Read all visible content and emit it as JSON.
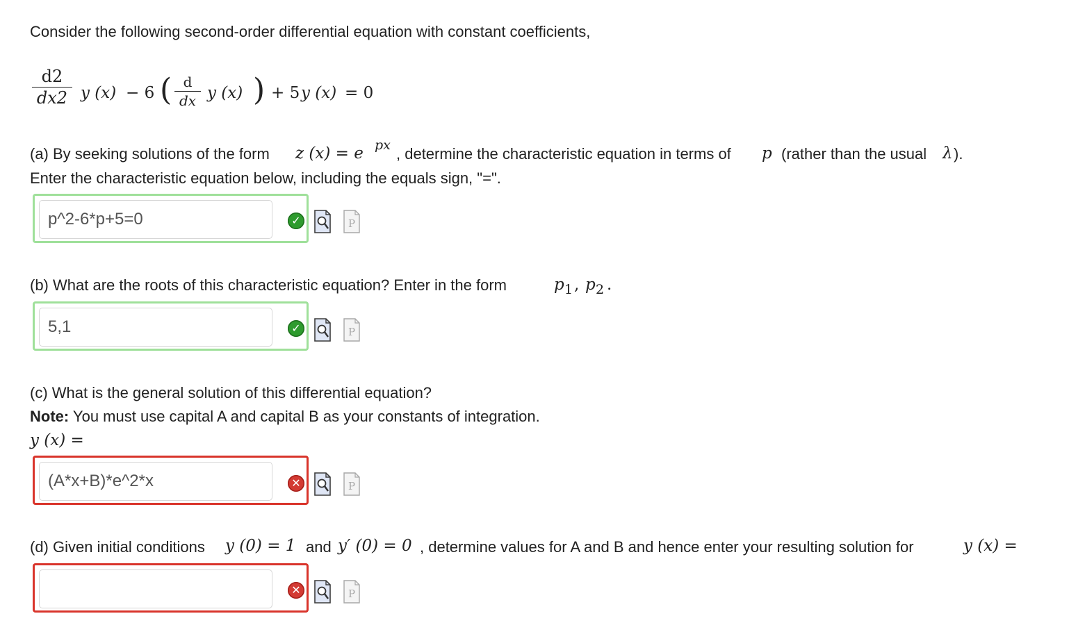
{
  "intro": "Consider the following second-order differential equation with constant coefficients,",
  "equation": {
    "d2": "d2",
    "dx2": "dx2",
    "y_x1": "y (x)",
    "minus6": "− 6",
    "d": "d",
    "dx": "dx",
    "y_x2": "y (x)",
    "plus5": "+ 5",
    "y_x3": "y (x)",
    "eq0": "= 0"
  },
  "part_a": {
    "text1": "(a) By seeking solutions of the form",
    "form": "z (x) = e",
    "exp": "px",
    "text2": ", determine the characteristic equation in terms of",
    "p": "p",
    "text3": "(rather than the usual",
    "lambda": "λ",
    "text4": ").",
    "line2": "Enter the characteristic equation below, including the equals sign, \"=\".",
    "answer": "p^2-6*p+5=0",
    "status": "correct"
  },
  "part_b": {
    "text1": "(b) What are the roots of this characteristic equation? Enter in the form",
    "form": "p",
    "sub1": "1",
    "comma": ",",
    "form2": "p",
    "sub2": "2",
    "period": ".",
    "answer": "5,1",
    "status": "correct"
  },
  "part_c": {
    "line1": "(c) What is the general solution of this differential equation?",
    "note_bold": "Note:",
    "note_rest": " You must use capital A and capital B as your constants of integration.",
    "lhs": "y (x) =",
    "answer": "(A*x+B)*e^2*x",
    "status": "incorrect"
  },
  "part_d": {
    "text1": "(d) Given initial conditions",
    "cond1": "y (0) = 1",
    "and": "and",
    "cond2": "y′ (0) = 0",
    "text2": ", determine values for A and B and hence enter your resulting solution for",
    "lhs": "y (x) =",
    "answer": "",
    "status": "incorrect"
  },
  "icons": {
    "correct": "check-icon",
    "incorrect": "x-icon",
    "preview": "preview-magnifier-icon",
    "previous": "previous-answer-icon"
  },
  "colors": {
    "correct_border": "#9fe09a",
    "incorrect_border": "#d9342b",
    "check_green": "#2e9b2e",
    "x_red": "#d33a33"
  }
}
